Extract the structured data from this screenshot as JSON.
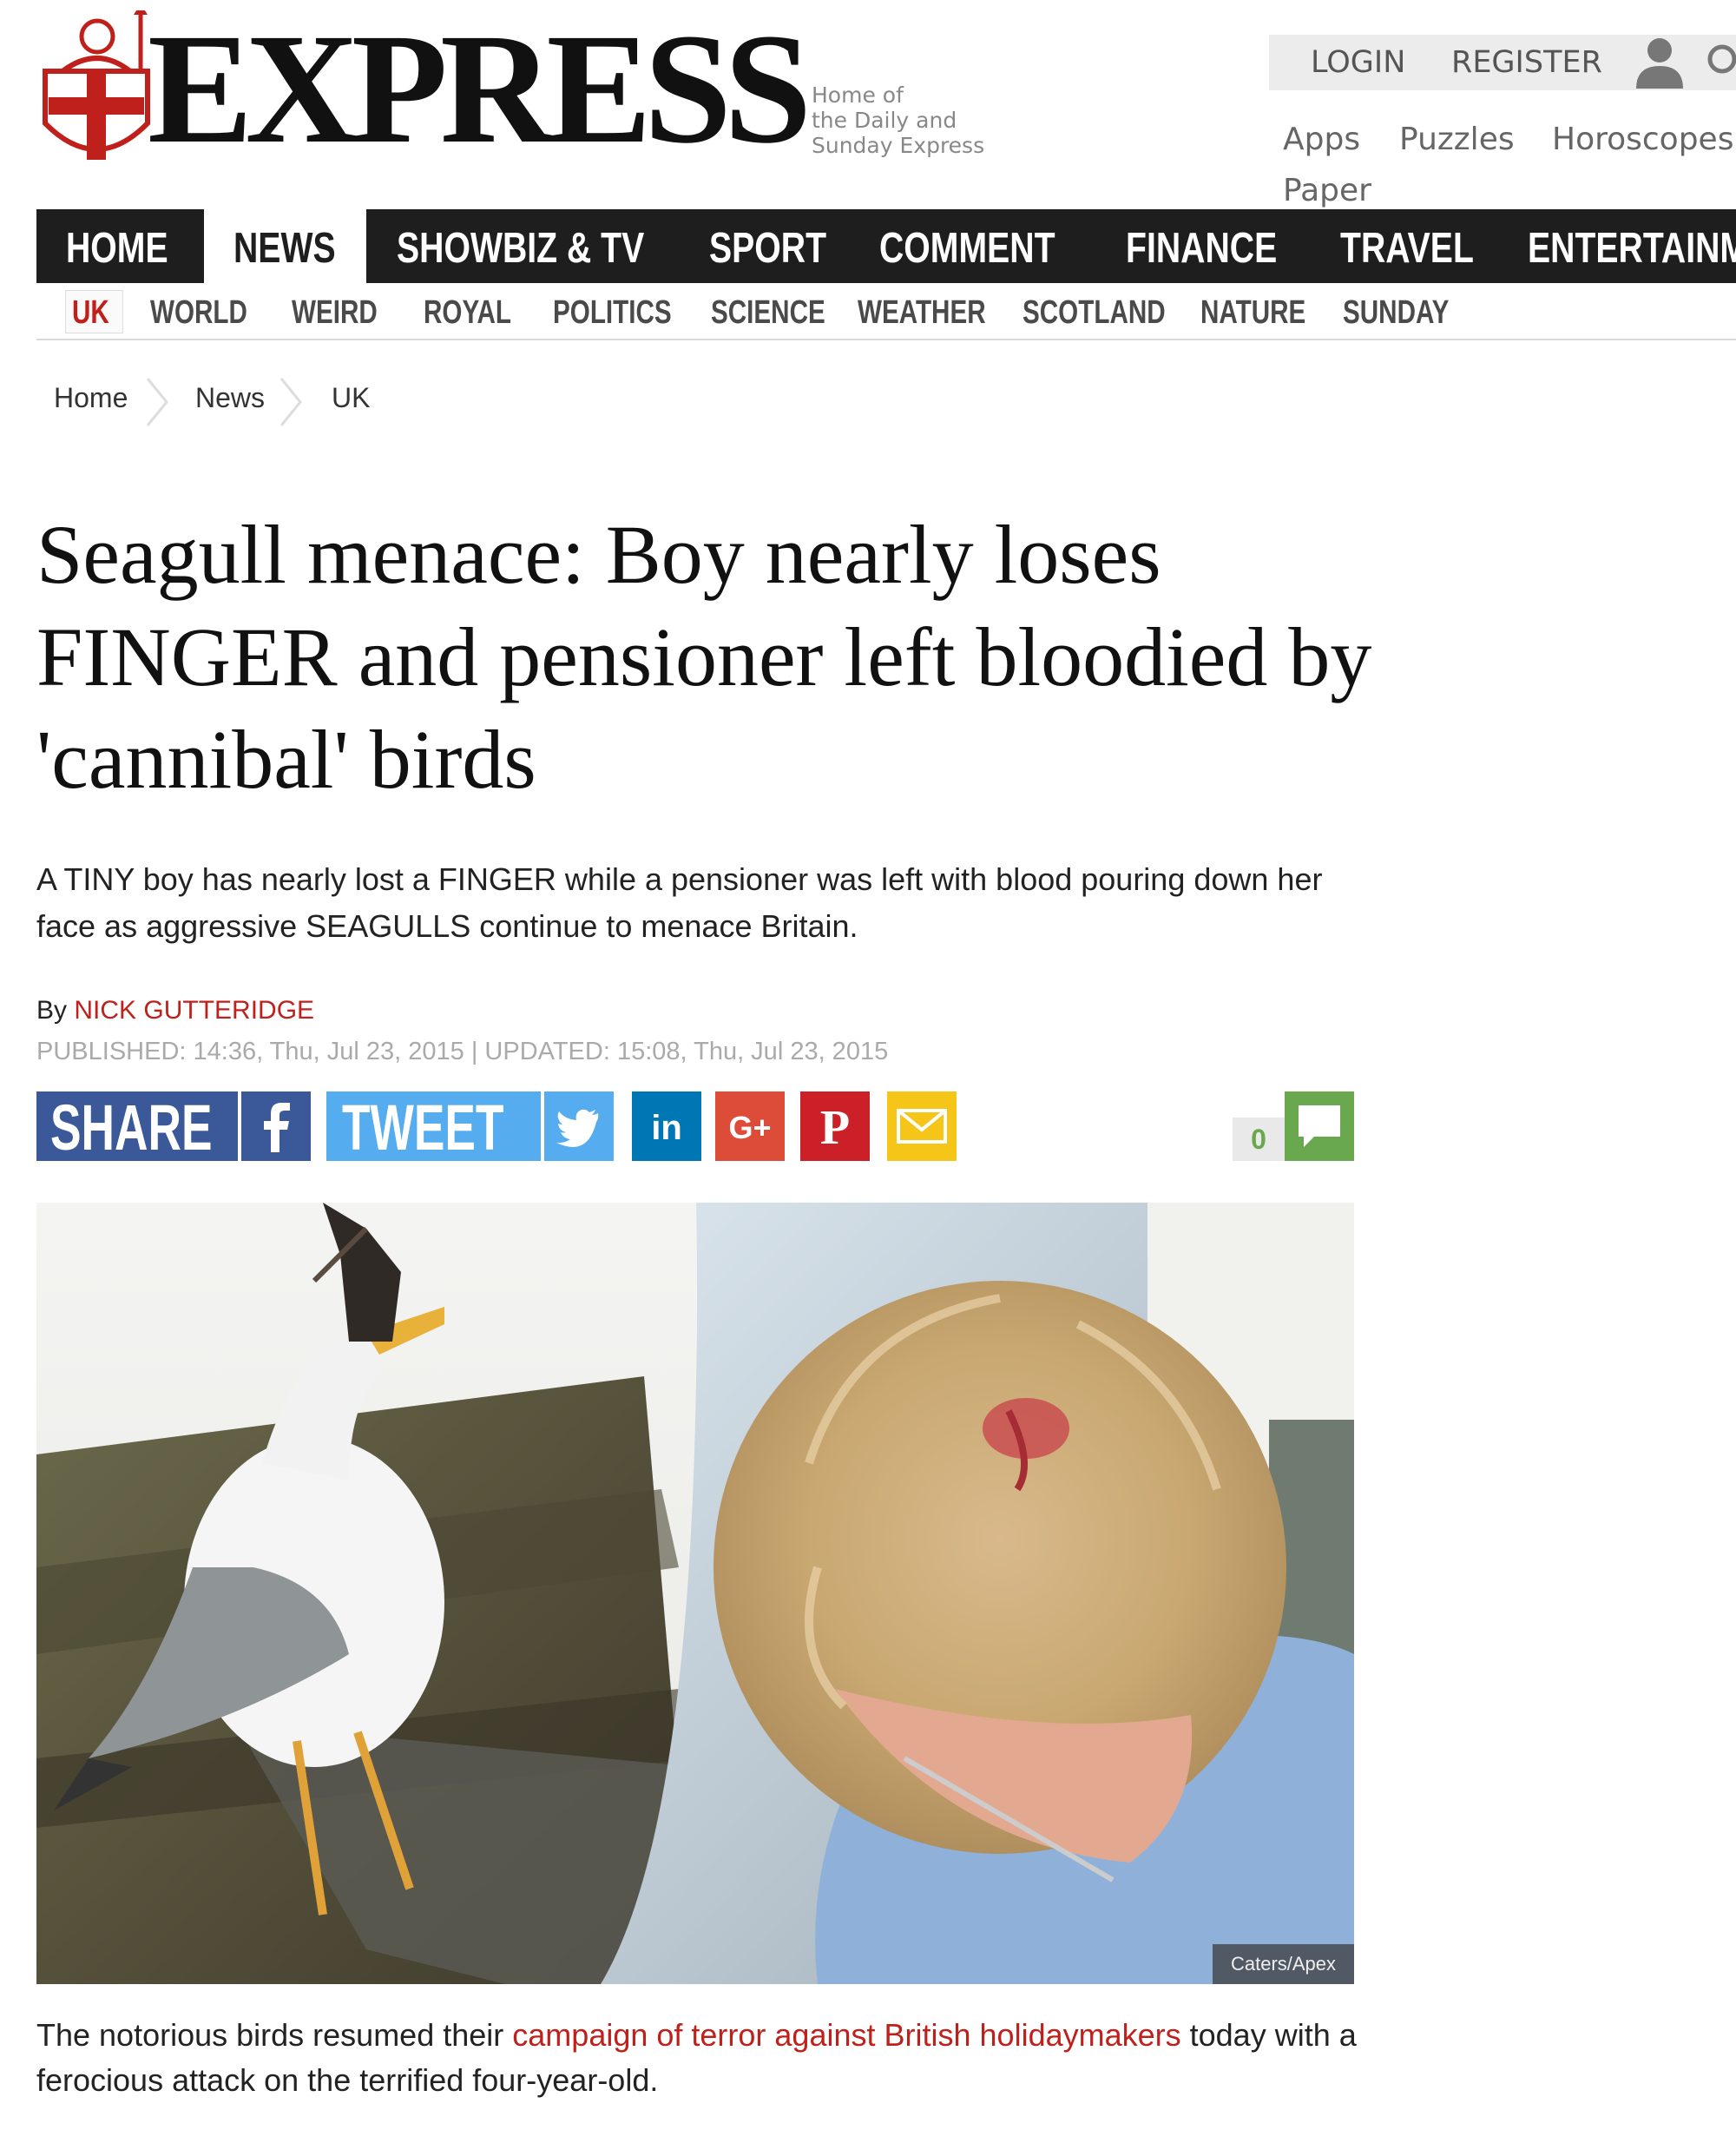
{
  "masthead": {
    "logo_text": "EXPRESS",
    "tagline": [
      "Home of",
      "the Daily and",
      "Sunday Express"
    ],
    "login": "LOGIN",
    "register": "REGISTER",
    "links": [
      "Apps",
      "Puzzles",
      "Horoscopes",
      "Paper"
    ]
  },
  "nav": {
    "primary": [
      "HOME",
      "NEWS",
      "SHOWBIZ & TV",
      "SPORT",
      "COMMENT",
      "FINANCE",
      "TRAVEL",
      "ENTERTAINMENT"
    ],
    "active_primary": "NEWS",
    "secondary": [
      "UK",
      "WORLD",
      "WEIRD",
      "ROYAL",
      "POLITICS",
      "SCIENCE",
      "WEATHER",
      "SCOTLAND",
      "NATURE",
      "SUNDAY"
    ],
    "active_secondary": "UK"
  },
  "breadcrumb": [
    "Home",
    "News",
    "UK"
  ],
  "article": {
    "headline": "Seagull menace: Boy nearly loses FINGER and pensioner left bloodied by 'cannibal' birds",
    "standfirst": "A TINY boy has nearly lost a FINGER while a pensioner was left with blood pouring down her face as aggressive SEAGULLS continue to menace Britain.",
    "by": "By",
    "author": "NICK GUTTERIDGE",
    "dates": "PUBLISHED: 14:36, Thu, Jul 23, 2015 | UPDATED: 15:08, Thu, Jul 23, 2015",
    "photo_credit": "Caters/Apex",
    "caption_before": "The notorious birds resumed their",
    "caption_link": "campaign of terror against British holidaymakers",
    "caption_after": "today with a ferocious attack on the terrified four-year-old."
  },
  "share": {
    "share_label": "SHARE",
    "tweet_label": "TWEET",
    "comment_count": "0",
    "colors": {
      "facebook": "#3b5998",
      "twitter": "#55acee",
      "linkedin": "#0077b5",
      "googleplus": "#dd4b39",
      "pinterest": "#cb2027",
      "email": "#f5c518",
      "comments": "#6aa84f"
    }
  },
  "colors": {
    "accent": "#c0201b",
    "nav_bg": "#1e1e1e"
  }
}
